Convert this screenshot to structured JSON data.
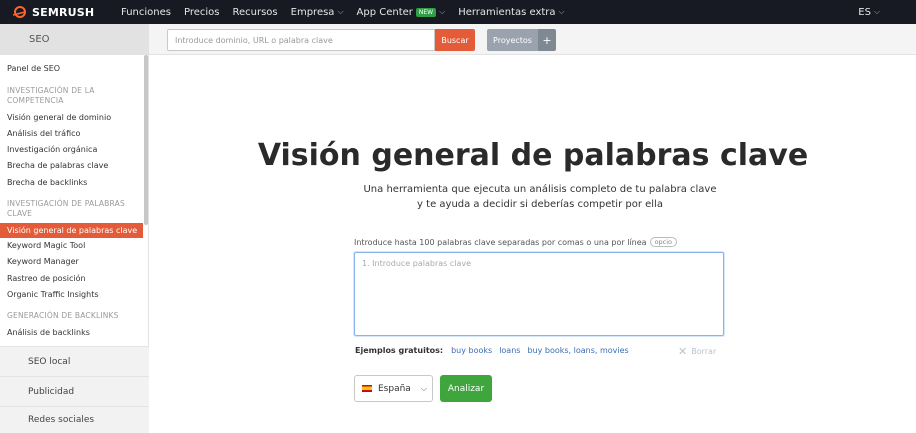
{
  "topnav": {
    "brand": "SEMRUSH",
    "items": [
      "Funciones",
      "Precios",
      "Recursos",
      "Empresa",
      "App Center",
      "Herramientas extra"
    ],
    "app_center_badge": "NEW",
    "lang": "ES"
  },
  "subbar": {
    "section": "SEO",
    "search_placeholder": "Introduce dominio, URL o palabra clave",
    "search_button": "Buscar",
    "projects_button": "Proyectos",
    "plus": "+"
  },
  "sidebar": {
    "panel": "Panel de SEO",
    "section1": "INVESTIGACIÓN DE LA COMPETENCIA",
    "comp_items": [
      "Visión general de dominio",
      "Análisis del tráfico",
      "Investigación orgánica",
      "Brecha de palabras clave",
      "Brecha de backlinks"
    ],
    "section2": "INVESTIGACIÓN DE PALABRAS CLAVE",
    "active_item": "Visión general de palabras clave",
    "kw_items": [
      "Keyword Magic Tool",
      "Keyword Manager",
      "Rastreo de posición",
      "Organic Traffic Insights"
    ],
    "section3": "GENERACIÓN DE BACKLINKS",
    "backlink_items": [
      "Análisis de backlinks"
    ],
    "bottom_items": [
      "SEO local",
      "Publicidad",
      "Redes sociales"
    ]
  },
  "main": {
    "title": "Visión general de palabras clave",
    "subtitle": "Una herramienta que ejecuta un análisis completo de tu palabra clave y te ayuda a decidir si deberías competir por ella",
    "textarea_label": "Introduce hasta 100 palabras clave separadas por comas o una por línea",
    "optional_tag": "opcio",
    "textarea_placeholder": "1. Introduce palabras clave",
    "examples_label": "Ejemplos gratuitos:",
    "examples": [
      "buy books",
      "loans",
      "buy books, loans, movies"
    ],
    "clear_label": "Borrar",
    "country": "España",
    "analyze_button": "Analizar"
  },
  "colors": {
    "accent_orange": "#e35b38",
    "analyze_green": "#3fa63d",
    "topbar_dark": "#171a22"
  }
}
